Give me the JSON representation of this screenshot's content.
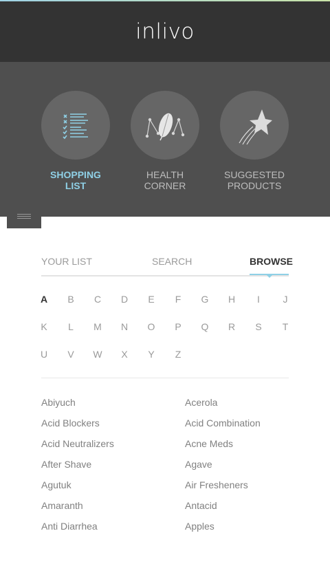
{
  "app": {
    "logo": "inlivo",
    "accent_color": "#8fd0e6"
  },
  "categories": [
    {
      "label_line1": "SHOPPING",
      "label_line2": "LIST",
      "icon": "checklist-icon",
      "active": true
    },
    {
      "label_line1": "HEALTH",
      "label_line2": "CORNER",
      "icon": "leaf-icon",
      "active": false
    },
    {
      "label_line1": "SUGGESTED",
      "label_line2": "PRODUCTS",
      "icon": "shooting-star-icon",
      "active": false
    }
  ],
  "menu": {
    "icon": "hamburger-icon"
  },
  "tabs": [
    {
      "label": "YOUR LIST",
      "active": false
    },
    {
      "label": "SEARCH",
      "active": false
    },
    {
      "label": "BROWSE",
      "active": true
    }
  ],
  "alphabet": {
    "selected": "A",
    "letters": [
      "A",
      "B",
      "C",
      "D",
      "E",
      "F",
      "G",
      "H",
      "I",
      "J",
      "K",
      "L",
      "M",
      "N",
      "O",
      "P",
      "Q",
      "R",
      "S",
      "T",
      "U",
      "V",
      "W",
      "X",
      "Y",
      "Z"
    ]
  },
  "items_left": [
    "Abiyuch",
    "Acid Blockers",
    "Acid Neutralizers",
    "After Shave",
    "Agutuk",
    "Amaranth",
    "Anti Diarrhea"
  ],
  "items_right": [
    "Acerola",
    "Acid Combination",
    "Acne Meds",
    "Agave",
    "Air Fresheners",
    "Antacid",
    "Apples"
  ]
}
